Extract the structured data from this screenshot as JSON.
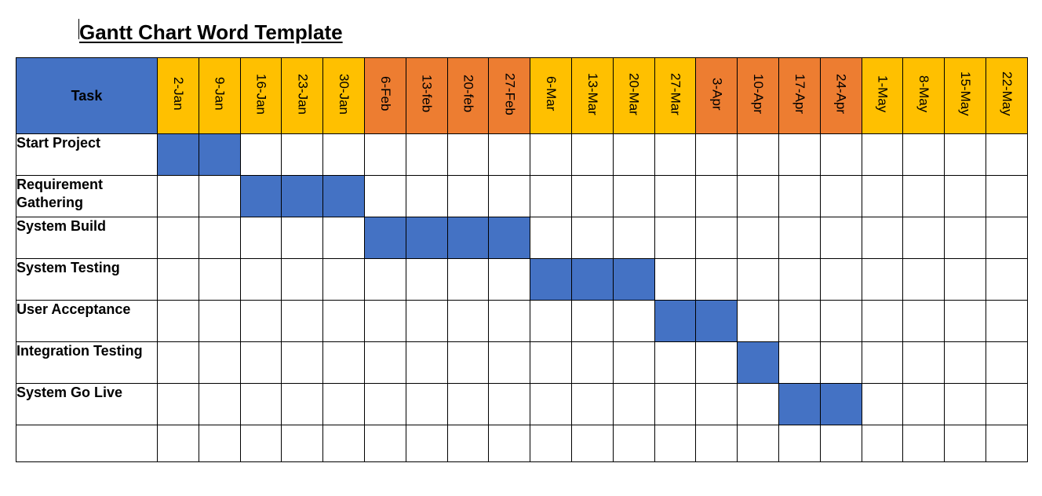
{
  "title": "Gantt Chart Word Template",
  "header": {
    "task_label": "Task"
  },
  "colors": {
    "bar": "#4472c4",
    "month_primary": "#ffc000",
    "month_alt": "#ed7d31"
  },
  "dates": [
    {
      "label": "2-Jan",
      "month_class": "m-jan"
    },
    {
      "label": "9-Jan",
      "month_class": "m-jan"
    },
    {
      "label": "16-Jan",
      "month_class": "m-jan"
    },
    {
      "label": "23-Jan",
      "month_class": "m-jan"
    },
    {
      "label": "30-Jan",
      "month_class": "m-jan"
    },
    {
      "label": "6-Feb",
      "month_class": "m-feb"
    },
    {
      "label": "13-feb",
      "month_class": "m-feb"
    },
    {
      "label": "20-feb",
      "month_class": "m-feb"
    },
    {
      "label": "27-Feb",
      "month_class": "m-feb"
    },
    {
      "label": "6-Mar",
      "month_class": "m-mar"
    },
    {
      "label": "13-Mar",
      "month_class": "m-mar"
    },
    {
      "label": "20-Mar",
      "month_class": "m-mar"
    },
    {
      "label": "27-Mar",
      "month_class": "m-mar"
    },
    {
      "label": "3-Apr",
      "month_class": "m-apr"
    },
    {
      "label": "10-Apr",
      "month_class": "m-apr"
    },
    {
      "label": "17-Apr",
      "month_class": "m-apr"
    },
    {
      "label": "24-Apr",
      "month_class": "m-apr"
    },
    {
      "label": "1-May",
      "month_class": "m-may"
    },
    {
      "label": "8-May",
      "month_class": "m-may"
    },
    {
      "label": "15-May",
      "month_class": "m-may"
    },
    {
      "label": "22-May",
      "month_class": "m-may"
    }
  ],
  "tasks": [
    {
      "name": "Start Project",
      "start": 0,
      "span": 2
    },
    {
      "name": "Requirement Gathering",
      "start": 2,
      "span": 3
    },
    {
      "name": "System Build",
      "start": 5,
      "span": 4
    },
    {
      "name": "System Testing",
      "start": 9,
      "span": 3
    },
    {
      "name": "User Acceptance",
      "start": 12,
      "span": 2
    },
    {
      "name": "Integration Testing",
      "start": 14,
      "span": 1
    },
    {
      "name": "System Go Live",
      "start": 15,
      "span": 2
    }
  ],
  "trailing_blank_rows": 1,
  "chart_data": {
    "type": "bar",
    "orientation": "horizontal-gantt",
    "title": "Gantt Chart Word Template",
    "x_categories": [
      "2-Jan",
      "9-Jan",
      "16-Jan",
      "23-Jan",
      "30-Jan",
      "6-Feb",
      "13-feb",
      "20-feb",
      "27-Feb",
      "6-Mar",
      "13-Mar",
      "20-Mar",
      "27-Mar",
      "3-Apr",
      "10-Apr",
      "17-Apr",
      "24-Apr",
      "1-May",
      "8-May",
      "15-May",
      "22-May"
    ],
    "y_categories": [
      "Start Project",
      "Requirement Gathering",
      "System Build",
      "System Testing",
      "User Acceptance",
      "Integration Testing",
      "System Go Live"
    ],
    "series": [
      {
        "name": "Start Project",
        "start_index": 0,
        "duration_weeks": 2,
        "start_label": "2-Jan",
        "end_label": "9-Jan"
      },
      {
        "name": "Requirement Gathering",
        "start_index": 2,
        "duration_weeks": 3,
        "start_label": "16-Jan",
        "end_label": "30-Jan"
      },
      {
        "name": "System Build",
        "start_index": 5,
        "duration_weeks": 4,
        "start_label": "6-Feb",
        "end_label": "27-Feb"
      },
      {
        "name": "System Testing",
        "start_index": 9,
        "duration_weeks": 3,
        "start_label": "6-Mar",
        "end_label": "20-Mar"
      },
      {
        "name": "User Acceptance",
        "start_index": 12,
        "duration_weeks": 2,
        "start_label": "27-Mar",
        "end_label": "3-Apr"
      },
      {
        "name": "Integration Testing",
        "start_index": 14,
        "duration_weeks": 1,
        "start_label": "10-Apr",
        "end_label": "10-Apr"
      },
      {
        "name": "System Go Live",
        "start_index": 15,
        "duration_weeks": 2,
        "start_label": "17-Apr",
        "end_label": "24-Apr"
      }
    ],
    "xlabel": "",
    "ylabel": "Task",
    "legend": false
  }
}
